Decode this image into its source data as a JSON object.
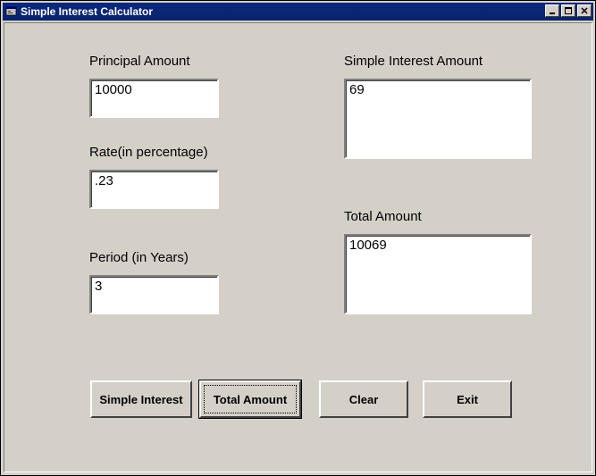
{
  "window": {
    "title": "Simple Interest Calculator"
  },
  "labels": {
    "principal": "Principal Amount",
    "rate": "Rate(in percentage)",
    "period": "Period (in Years)",
    "simple_interest": "Simple Interest Amount",
    "total_amount": "Total Amount"
  },
  "fields": {
    "principal": "10000",
    "rate": ".23",
    "period": "3",
    "simple_interest": "69",
    "total_amount": "10069"
  },
  "buttons": {
    "simple_interest": "Simple Interest",
    "total_amount": "Total Amount",
    "clear": "Clear",
    "exit": "Exit"
  },
  "title_buttons": {
    "minimize": "_",
    "maximize": "□",
    "close": "X"
  }
}
